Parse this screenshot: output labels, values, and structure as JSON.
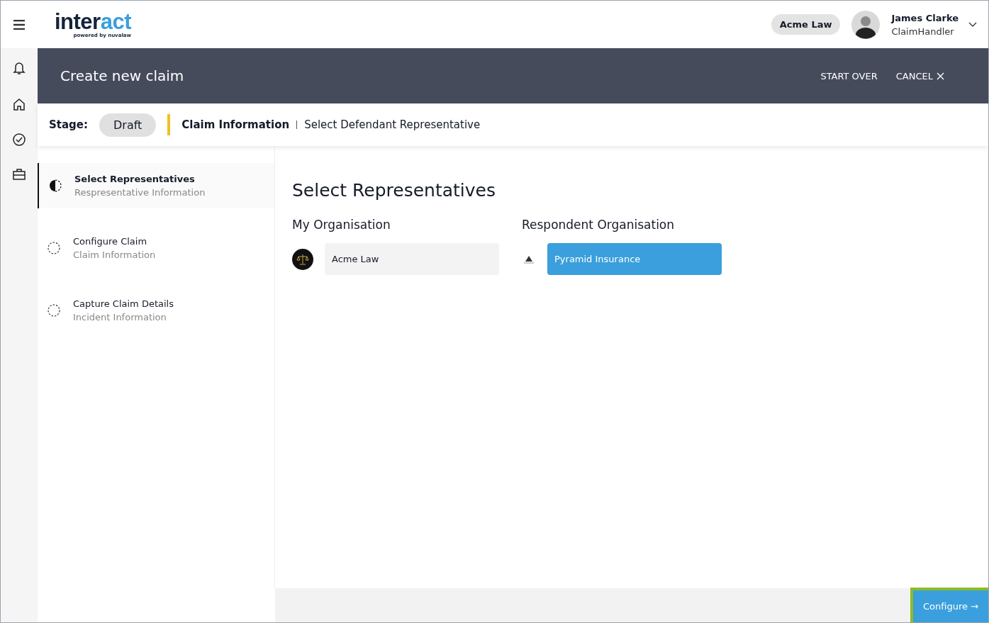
{
  "logo": {
    "part_1": "inter",
    "part_2": "act",
    "tagline": "powered by nuvalaw"
  },
  "header": {
    "organisation": "Acme Law",
    "user_name": "James Clarke",
    "user_role": "ClaimHandler"
  },
  "banner": {
    "title": "Create new claim",
    "actions": [
      "START OVER",
      "CANCEL"
    ]
  },
  "stage_bar": {
    "label": "Stage:",
    "stage": "Draft",
    "section": "Claim Information",
    "subsection": "Select Defendant Representative"
  },
  "steps": [
    {
      "title": "Select Representatives",
      "subtitle": "Respresentative Information",
      "selected": true
    },
    {
      "title": "Configure Claim",
      "subtitle": "Claim Information",
      "selected": false
    },
    {
      "title": "Capture Claim Details",
      "subtitle": "Incident Information",
      "selected": false
    }
  ],
  "content": {
    "title": "Select Representatives",
    "organisations": [
      {
        "heading": "My Organisation",
        "name": "Acme Law",
        "selected": false
      },
      {
        "heading": "Respondent Organisation",
        "name": "Pyramid Insurance",
        "selected": true
      }
    ]
  },
  "footer": {
    "button": "Configure →",
    "highlighted": true
  }
}
